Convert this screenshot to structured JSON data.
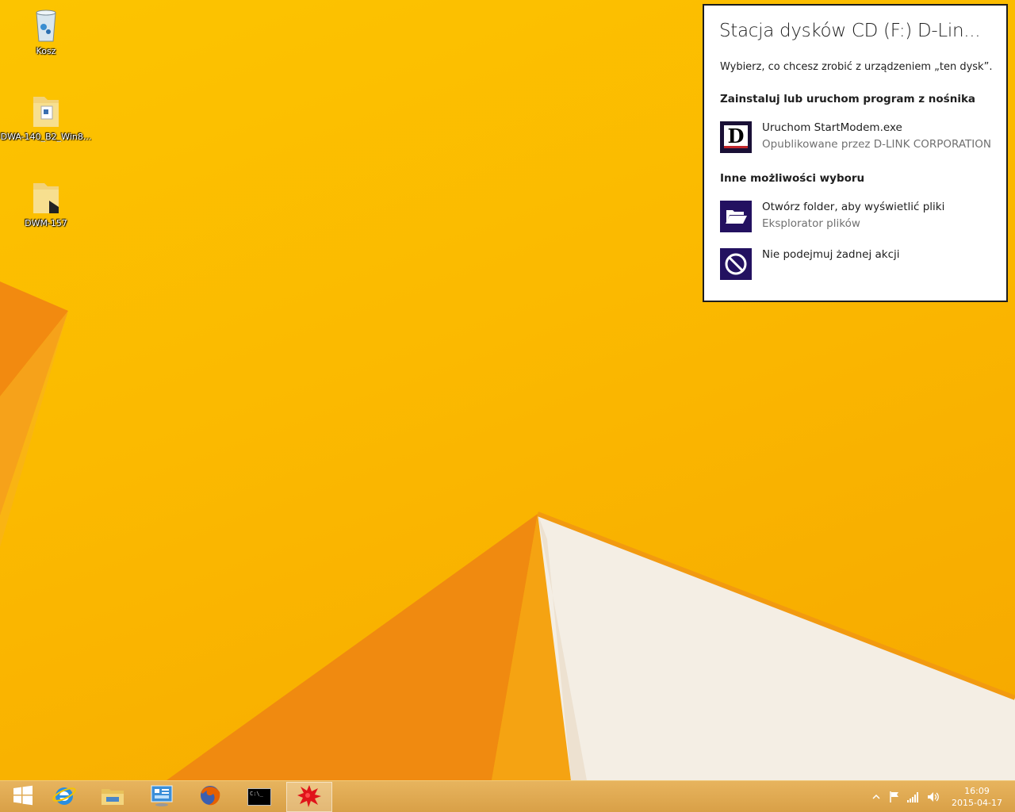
{
  "desktop": {
    "icons": [
      {
        "label": "Kosz",
        "icon": "recycle-bin-icon"
      },
      {
        "label": "DWA-140_B2_Win8...",
        "icon": "folder-icon"
      },
      {
        "label": "DWM-157",
        "icon": "folder-icon"
      }
    ]
  },
  "autoplay": {
    "title": "Stacja dysków CD (F:) D-Lin...",
    "subtitle": "Wybierz, co chcesz zrobić z urządzeniem „ten dysk”.",
    "section_install": "Zainstaluj lub uruchom program z nośnika",
    "section_other": "Inne możliwości wyboru",
    "options": [
      {
        "main": "Uruchom StartModem.exe",
        "sub": "Opublikowane przez D-LINK CORPORATION",
        "icon": "dlink-logo-icon"
      },
      {
        "main": "Otwórz folder, aby wyświetlić pliki",
        "sub": "Eksplorator plików",
        "icon": "open-folder-icon"
      },
      {
        "main": "Nie podejmuj żadnej akcji",
        "sub": "",
        "icon": "no-action-icon"
      }
    ],
    "accent_color": "#231160",
    "dlink_letter": "D"
  },
  "taskbar": {
    "buttons": [
      {
        "icon": "windows-start-icon"
      },
      {
        "icon": "internet-explorer-icon"
      },
      {
        "icon": "file-explorer-icon"
      },
      {
        "icon": "control-panel-icon"
      },
      {
        "icon": "firefox-icon"
      },
      {
        "icon": "command-prompt-icon",
        "text": "C:\\_"
      },
      {
        "icon": "paint-splash-icon"
      }
    ],
    "tray": [
      "show-hidden-icons-icon",
      "action-center-flag-icon",
      "network-signal-icon",
      "volume-icon"
    ],
    "clock": {
      "time": "16:09",
      "date": "2015-04-17"
    }
  }
}
